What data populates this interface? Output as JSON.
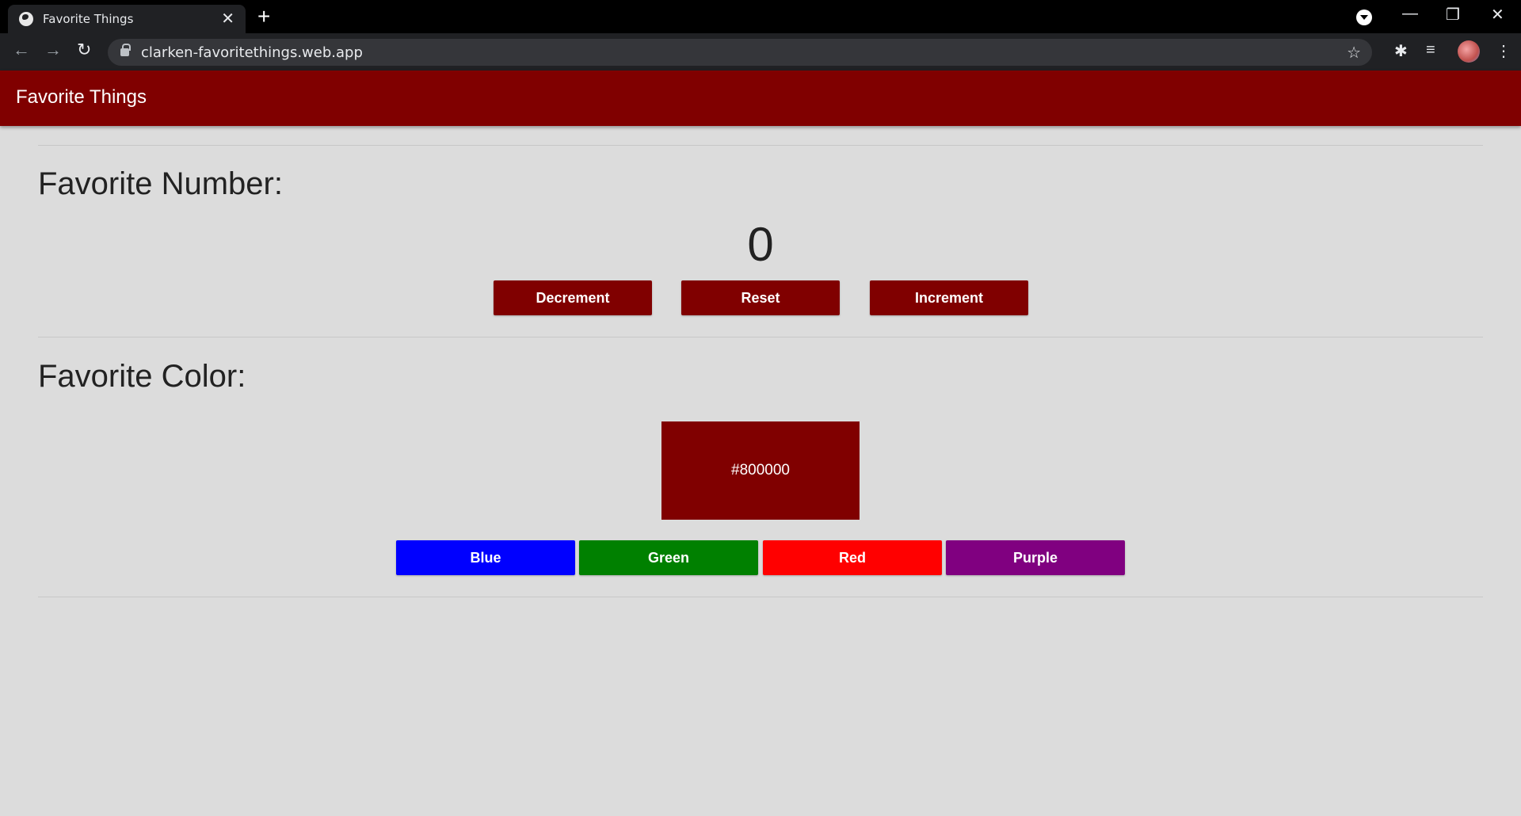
{
  "browser": {
    "tab_title": "Favorite Things",
    "url": "clarken-favoritethings.web.app"
  },
  "app": {
    "title": "Favorite Things"
  },
  "number_section": {
    "title": "Favorite Number:",
    "value": "0",
    "buttons": {
      "decrement": "Decrement",
      "reset": "Reset",
      "increment": "Increment"
    }
  },
  "color_section": {
    "title": "Favorite Color:",
    "current_color": "#800000",
    "buttons": {
      "blue": "Blue",
      "green": "Green",
      "red": "Red",
      "purple": "Purple"
    }
  },
  "colors": {
    "maroon": "#800000",
    "blue": "#0000ff",
    "green": "#008000",
    "red": "#ff0000",
    "purple": "#800080"
  }
}
